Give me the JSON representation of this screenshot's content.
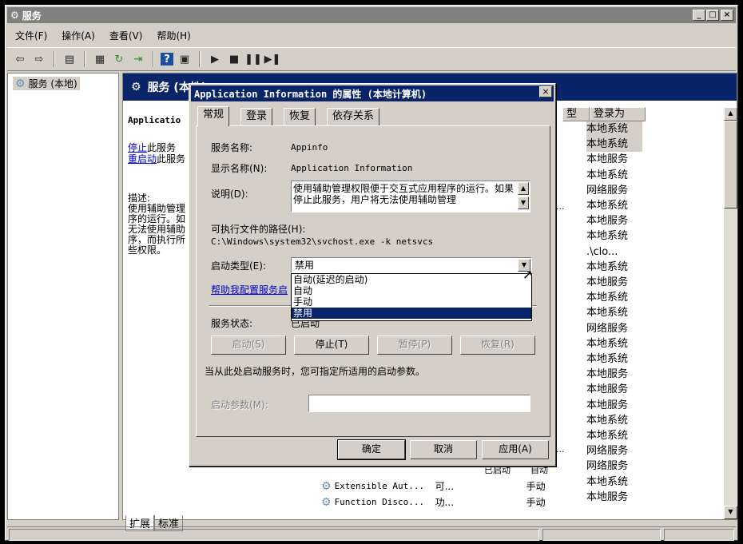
{
  "window": {
    "title": "服务",
    "min": "_",
    "max": "□",
    "close": "×"
  },
  "menu": [
    "文件(F)",
    "操作(A)",
    "查看(V)",
    "帮助(H)"
  ],
  "tree": {
    "item": "服务 (本地)"
  },
  "pane": {
    "title": "服务 (本地)",
    "service_name": "Applicatio",
    "stop_link": "停止",
    "stop_rest": "此服务",
    "restart_link": "重启动",
    "restart_rest": "此服务",
    "desc_label": "描述:",
    "desc_lines": [
      "使用辅助管理",
      "序的运行。如",
      "无法使用辅助",
      "序，而执行所",
      "些权限。"
    ]
  },
  "columns": {
    "type_fragment": "型",
    "logon": "登录为"
  },
  "logon_values": [
    "本地系统",
    "本地系统",
    "本地服务",
    "本地系统",
    "网络服务",
    "本地系统",
    "本地服务",
    "本地系统",
    ".\\clo...",
    "本地系统",
    "本地服务",
    "本地系统",
    "本地系统",
    "网络服务",
    "本地系统",
    "本地系统",
    "本地服务",
    "本地服务",
    "本地服务",
    "本地系统",
    "本地系统",
    "网络服务",
    "网络服务",
    "本地系统",
    "本地服务"
  ],
  "list_rows": [
    {
      "name": "Extensible Aut...",
      "desc": "可...",
      "start": "手动"
    },
    {
      "name": "Function Disco...",
      "desc": "功...",
      "start": "手动"
    }
  ],
  "row_ellipsis": [
    "...",
    "..."
  ],
  "list_partial": [
    "已启动",
    "自动"
  ],
  "bottom_tabs": [
    "扩展",
    "标准"
  ],
  "dialog": {
    "title": "Application Information 的属性 (本地计算机)",
    "close": "×",
    "tabs": [
      "常规",
      "登录",
      "恢复",
      "依存关系"
    ],
    "service_name_label": "服务名称:",
    "service_name": "Appinfo",
    "display_name_label": "显示名称(N):",
    "display_name": "Application Information",
    "desc_label": "说明(D):",
    "description": "使用辅助管理权限便于交互式应用程序的运行。如果停止此服务，用户将无法使用辅助管理",
    "path_label": "可执行文件的路径(H):",
    "path": "C:\\Windows\\system32\\svchost.exe -k netsvcs",
    "startup_label": "启动类型(E):",
    "startup_value": "禁用",
    "startup_options": [
      "自动(延迟的启动)",
      "自动",
      "手动",
      "禁用"
    ],
    "help_link": "帮助我配置服务启",
    "status_label": "服务状态:",
    "status_value": "已启动",
    "buttons": {
      "start": "启动(S)",
      "stop": "停止(T)",
      "pause": "暂停(P)",
      "resume": "恢复(R)"
    },
    "param_hint": "当从此处启动服务时，您可指定所适用的启动参数。",
    "param_label": "启动参数(M):",
    "ok": "确定",
    "cancel": "取消",
    "apply": "应用(A)"
  },
  "colors": {
    "title_active": "#0a246a",
    "title_inactive": "#808080",
    "face": "#d4d0c8",
    "link": "#0000cc"
  }
}
